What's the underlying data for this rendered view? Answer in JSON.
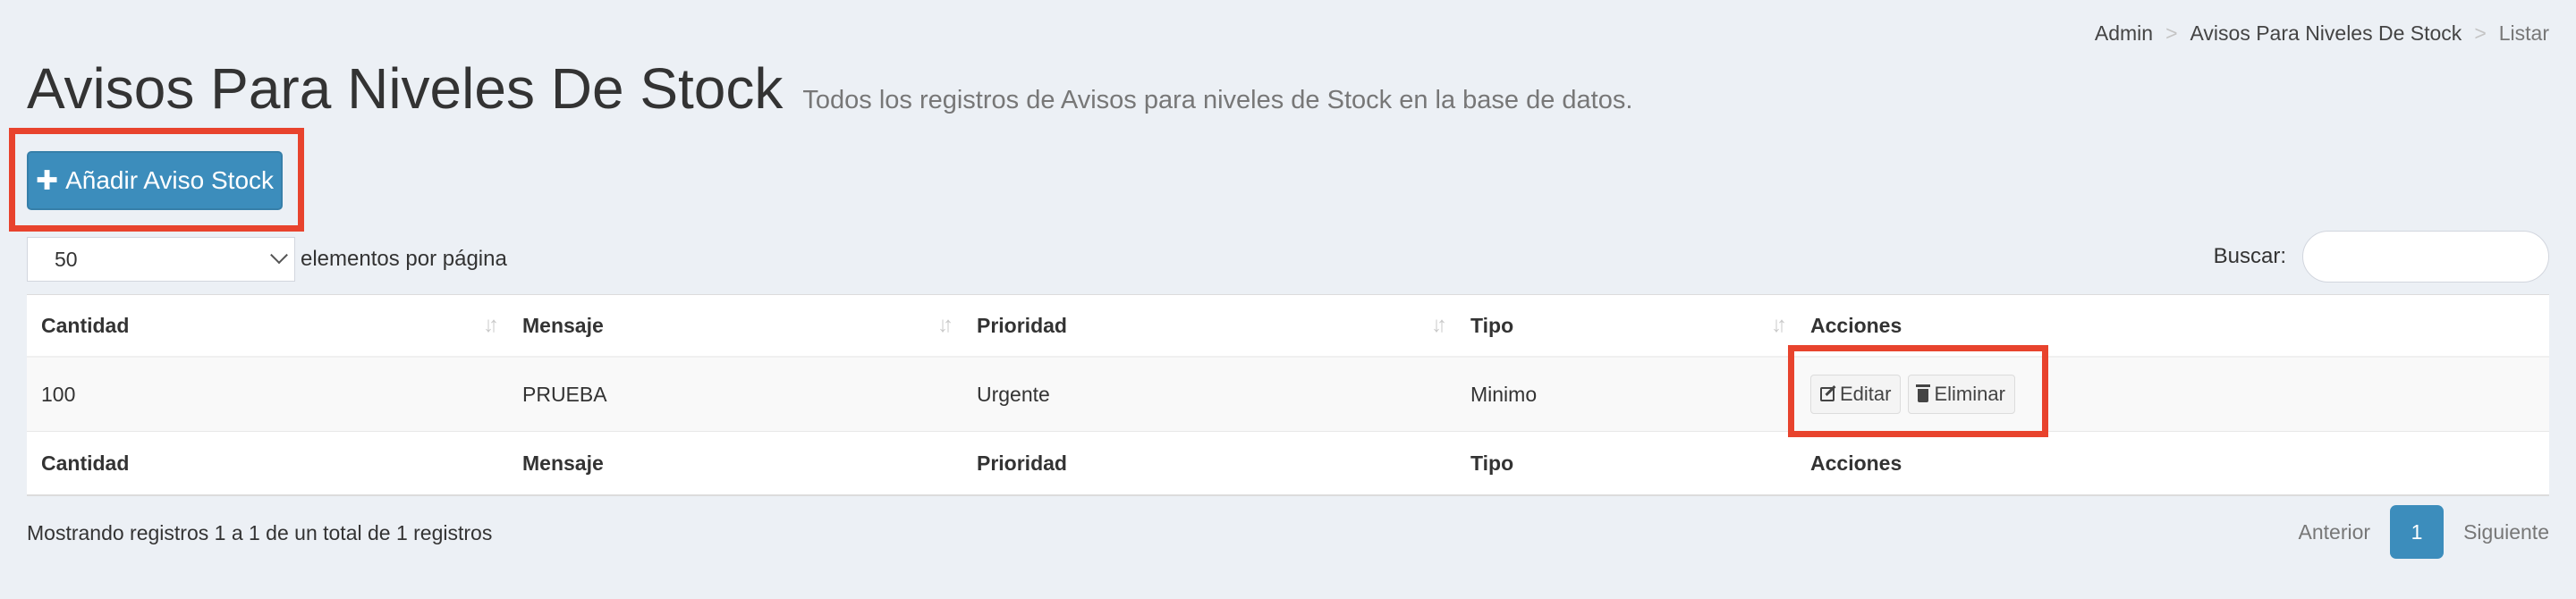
{
  "breadcrumb": {
    "items": [
      "Admin",
      "Avisos Para Niveles De Stock",
      "Listar"
    ],
    "separator": ">"
  },
  "header": {
    "title": "Avisos Para Niveles De Stock",
    "subtitle": "Todos los registros de Avisos para niveles de Stock en la base de datos."
  },
  "toolbar": {
    "add_label": "Añadir Aviso Stock",
    "add_icon": "plus-icon"
  },
  "length": {
    "selected": "50",
    "label": "elementos por página"
  },
  "search": {
    "label": "Buscar:",
    "value": "",
    "placeholder": ""
  },
  "table": {
    "headers": [
      "Cantidad",
      "Mensaje",
      "Prioridad",
      "Tipo",
      "Acciones"
    ],
    "rows": [
      {
        "cantidad": "100",
        "mensaje": "PRUEBA",
        "prioridad": "Urgente",
        "tipo": "Minimo",
        "edit_label": "Editar",
        "delete_label": "Eliminar"
      }
    ]
  },
  "footer": {
    "info": "Mostrando registros 1 a 1 de un total de 1 registros",
    "prev_label": "Anterior",
    "current_page": "1",
    "next_label": "Siguiente"
  },
  "colors": {
    "primary": "#3c8dbc",
    "highlight": "#e8432d",
    "background": "#ecf0f5"
  }
}
